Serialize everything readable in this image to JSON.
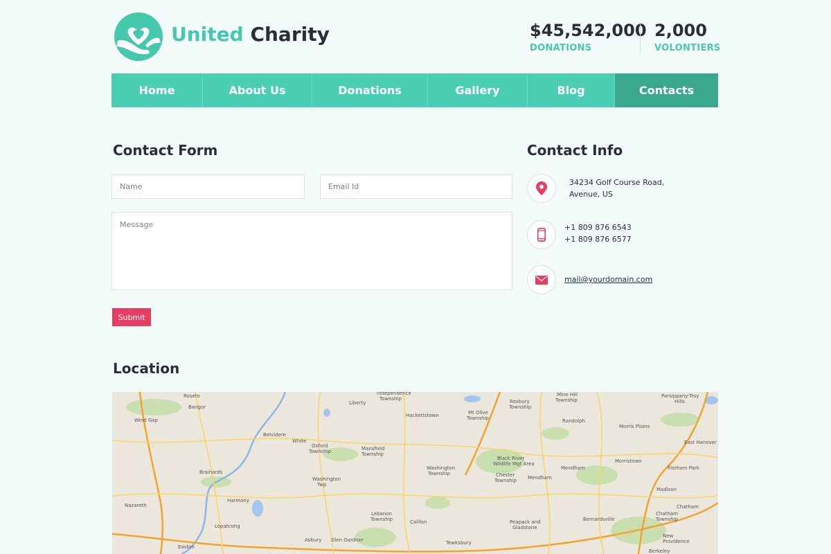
{
  "brand": {
    "first": "United",
    "second": "Charity"
  },
  "stats": [
    {
      "value": "$45,542,000",
      "label": "DONATIONS"
    },
    {
      "value": "2,000",
      "label": "VOLONTIERS"
    }
  ],
  "nav": [
    {
      "label": "Home",
      "active": false
    },
    {
      "label": "About Us",
      "active": false
    },
    {
      "label": "Donations",
      "active": false
    },
    {
      "label": "Gallery",
      "active": false
    },
    {
      "label": "Blog",
      "active": false
    },
    {
      "label": "Contacts",
      "active": true
    }
  ],
  "contact_form": {
    "title": "Contact Form",
    "name_placeholder": "Name",
    "email_placeholder": "Email Id",
    "message_placeholder": "Message",
    "submit_label": "Submit"
  },
  "contact_info": {
    "title": "Contact Info",
    "address_line1": "34234 Golf Course Road,",
    "address_line2": "Avenue, US",
    "phone1": "+1 809 876 6543",
    "phone2": "+1 809 876 6577",
    "email": "mail@yourdomain.com",
    "icons": [
      "map-pin-icon",
      "mobile-phone-icon",
      "envelope-icon"
    ],
    "icon_color": "#e83d63"
  },
  "location": {
    "title": "Location",
    "places": [
      "Roseto",
      "Bangor",
      "Wind Gap",
      "Nazareth",
      "Easton",
      "Belvidere",
      "White",
      "Oxford Township",
      "Brainards",
      "Harmony",
      "Lopatcong",
      "Washington Township",
      "Washington Twp",
      "Mansfield Township",
      "Liberty",
      "Hackettstown",
      "Mt Olive Township",
      "Roxbury Township",
      "Randolph",
      "Black River Wildlife Management Area",
      "Chester Township",
      "Mendham",
      "Morristown",
      "Morris Plains",
      "Parsippany-Troy Hills",
      "East Hanover",
      "Florham Park",
      "Madison",
      "Chatham",
      "Chatham Township",
      "Bernardsville",
      "Peapack and Gladstone",
      "Califon",
      "Lebanon Township",
      "Asbury",
      "Glen Gardner",
      "Tewksbury",
      "New Providence",
      "Berkeley Heights",
      "Independence Township",
      "Mine Hill Township"
    ]
  },
  "colors": {
    "accent": "#45c9ad",
    "nav_bg": "#4acfb4",
    "nav_active": "#3aa88f",
    "submit": "#e83d63"
  }
}
